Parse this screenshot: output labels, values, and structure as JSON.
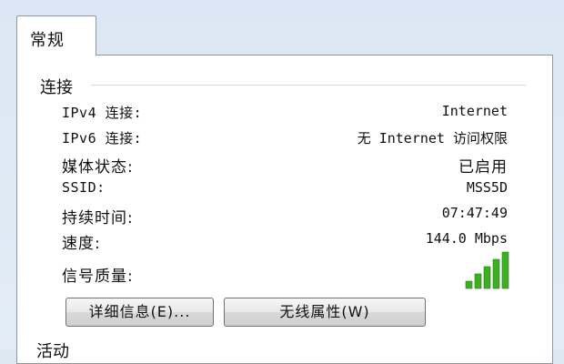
{
  "tab": {
    "label": "常规"
  },
  "connection": {
    "group_title": "连接",
    "rows": [
      {
        "label": "IPv4 连接:",
        "value": "Internet"
      },
      {
        "label": "IPv6 连接:",
        "value": "无 Internet 访问权限"
      },
      {
        "label": "媒体状态:",
        "value": "已启用"
      },
      {
        "label": "SSID:",
        "value": "MSS5D"
      },
      {
        "label": "持续时间:",
        "value": "07:47:49"
      },
      {
        "label": "速度:",
        "value": "144.0 Mbps"
      }
    ],
    "signal_label": "信号质量:",
    "signal_bars_lit": 5,
    "signal_bars_total": 5,
    "signal_color": "#3cb022"
  },
  "buttons": {
    "details": "详细信息(E)...",
    "wireless": "无线属性(W)"
  },
  "next_group": {
    "title_partial": "活动"
  }
}
